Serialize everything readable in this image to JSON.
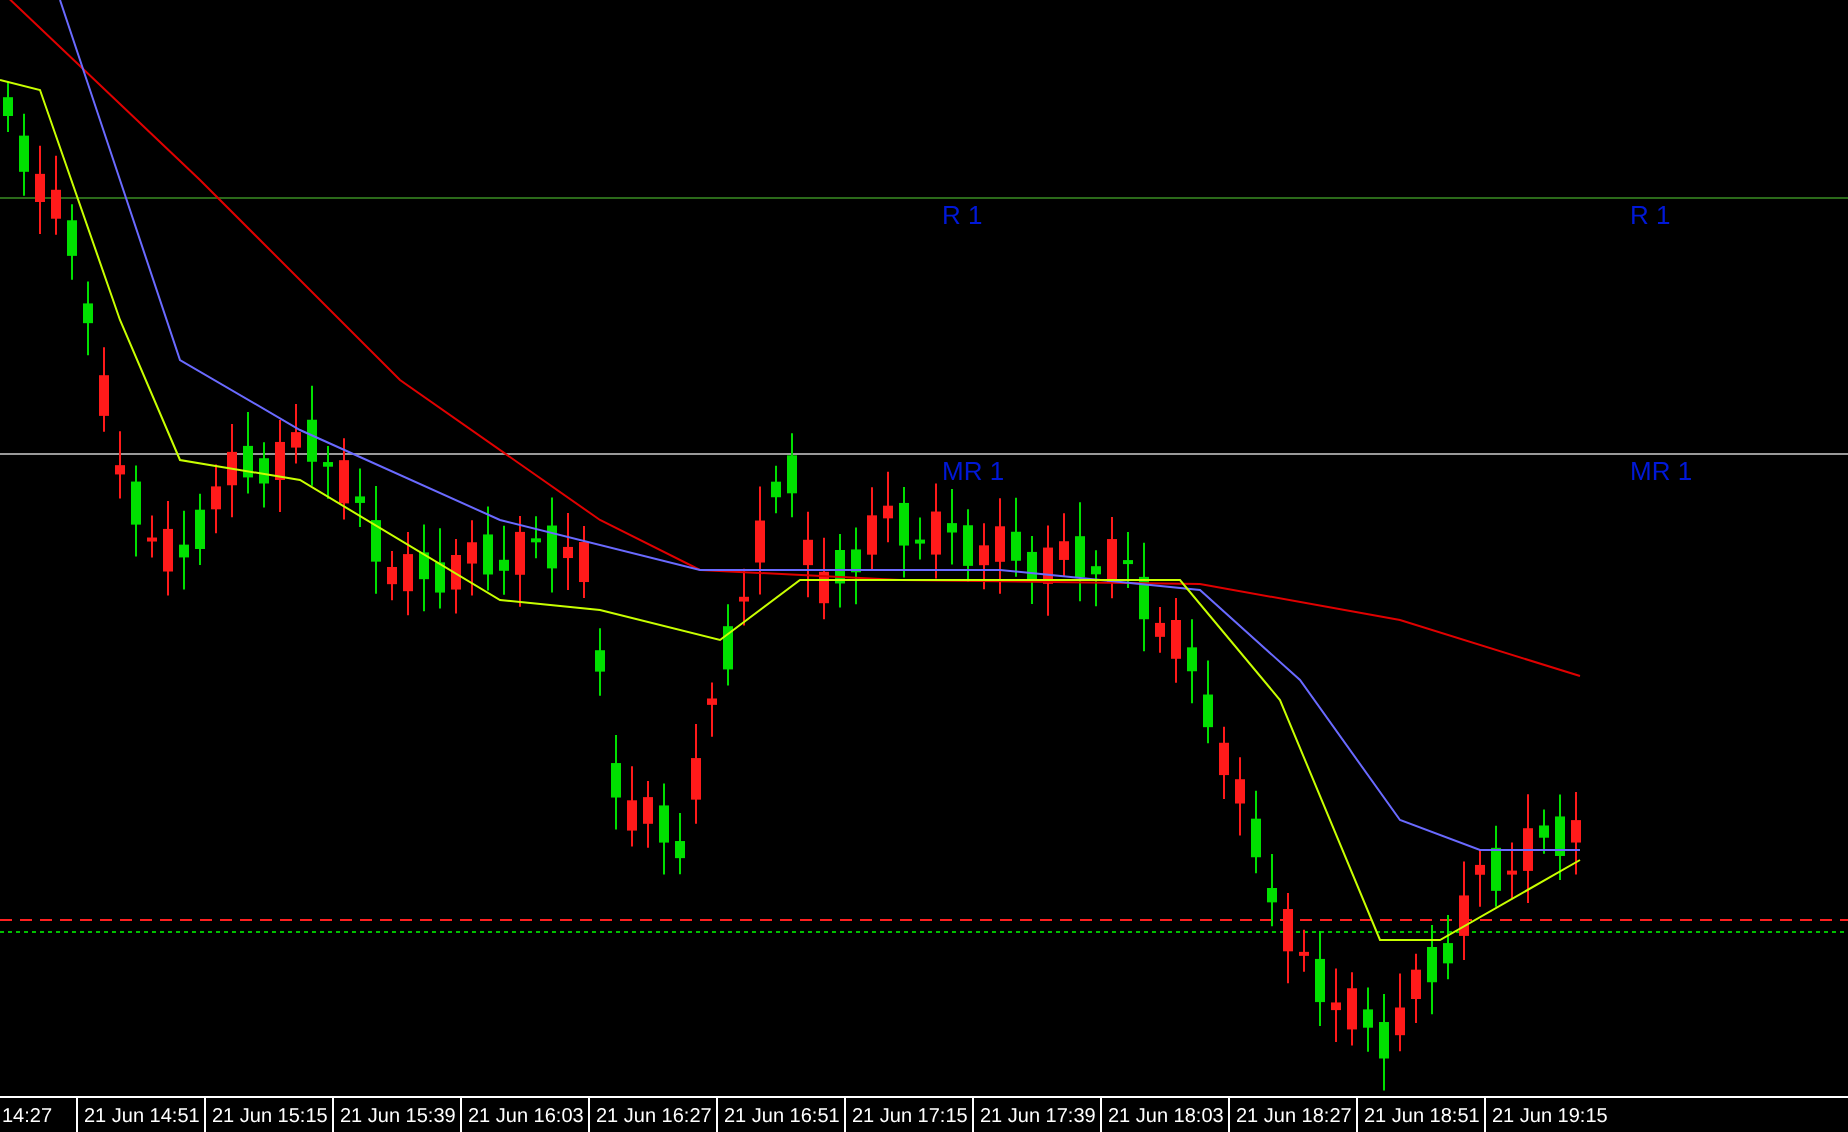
{
  "levels": [
    {
      "kind": "resistance",
      "labels": [
        "R 1",
        "R 1"
      ]
    },
    {
      "kind": "mid",
      "labels": [
        "MR 1",
        "MR 1"
      ]
    }
  ],
  "time_axis": {
    "labels": [
      "14:27",
      "21 Jun 14:51",
      "21 Jun 15:15",
      "21 Jun 15:39",
      "21 Jun 16:03",
      "21 Jun 16:27",
      "21 Jun 16:51",
      "21 Jun 17:15",
      "21 Jun 17:39",
      "21 Jun 18:03",
      "21 Jun 18:27",
      "21 Jun 18:51",
      "21 Jun 19:15"
    ]
  }
}
